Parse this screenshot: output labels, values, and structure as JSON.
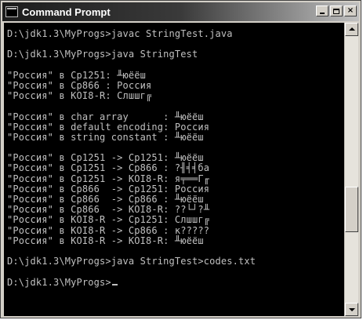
{
  "window": {
    "title": "Command Prompt",
    "buttons": {
      "minimize": "",
      "maximize": "",
      "close": "×"
    }
  },
  "console": {
    "lines": [
      "D:\\jdk1.3\\MyProgs>javac StringTest.java",
      "",
      "D:\\jdk1.3\\MyProgs>java StringTest",
      "",
      "\"Россия\" в Cp1251: ╨юёёш",
      "\"Россия\" в Cp866 : Россия",
      "\"Россия\" в KOI8-R: Слшшг╔",
      "",
      "\"Россия\" в char array      : ╨юёёш",
      "\"Россия\" в default encoding: Россия",
      "\"Россия\" в string constant : ╨юёёш",
      "",
      "\"Россия\" в Cp1251 -> Cp1251: ╨юёёш",
      "\"Россия\" в Cp1251 -> Cp866 : ?╢╡╡ба",
      "\"Россия\" в Cp1251 -> KOI8-R: я╤══Г╓",
      "\"Россия\" в Cp866  -> Cp1251: Россия",
      "\"Россия\" в Cp866  -> Cp866 : ╨юёёш",
      "\"Россия\" в Cp866  -> KOI8-R: ??└┘?╨",
      "\"Россия\" в KOI8-R -> Cp1251: Слшшг╔",
      "\"Россия\" в KOI8-R -> Cp866 : к?????",
      "\"Россия\" в KOI8-R -> KOI8-R: ╨юёёш",
      "",
      "D:\\jdk1.3\\MyProgs>java StringTest>codes.txt",
      "",
      "D:\\jdk1.3\\MyProgs>"
    ]
  },
  "scrollbar": {
    "position": 0.68
  }
}
